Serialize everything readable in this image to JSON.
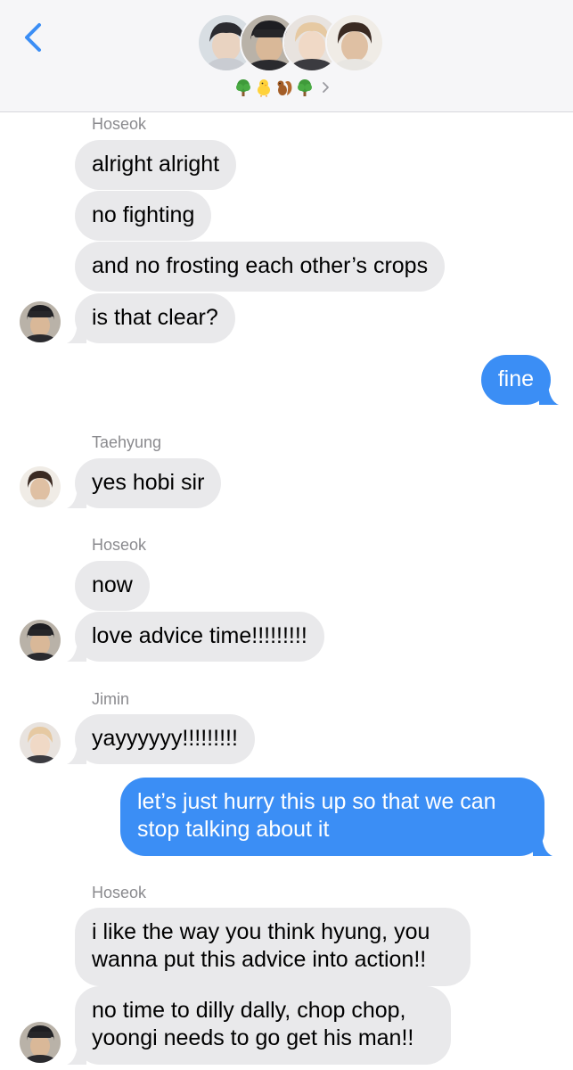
{
  "header": {
    "back_icon": "chevron-left-icon",
    "avatars": [
      "member-1",
      "member-2",
      "member-3",
      "member-4"
    ],
    "emoji": [
      "tree",
      "chick",
      "squirrel",
      "tree"
    ],
    "chevron_icon": "chevron-right-icon",
    "accent_color": "#3b8ef5"
  },
  "messages": [
    {
      "sender": "Hoseok",
      "text": "alright alright"
    },
    {
      "text": "no fighting"
    },
    {
      "text": "and no frosting each other’s crops"
    },
    {
      "text": "is that clear?"
    },
    {
      "text": "fine",
      "outgoing": true
    },
    {
      "sender": "Taehyung",
      "text": "yes hobi sir"
    },
    {
      "sender": "Hoseok",
      "text": "now"
    },
    {
      "text": "love advice time!!!!!!!!!"
    },
    {
      "sender": "Jimin",
      "text": "yayyyyyy!!!!!!!!!"
    },
    {
      "text": "let’s just hurry this up so that we can stop talking about it",
      "outgoing": true
    },
    {
      "sender": "Hoseok",
      "text": "i like the way you think hyung, you wanna put this advice into action!!"
    },
    {
      "text": "no time to dilly dally, chop chop, yoongi needs to go get his man!!"
    }
  ],
  "colors": {
    "incoming_bubble": "#e9e9eb",
    "outgoing_bubble": "#3b8ef5",
    "sender_label": "#8a8a8e"
  }
}
